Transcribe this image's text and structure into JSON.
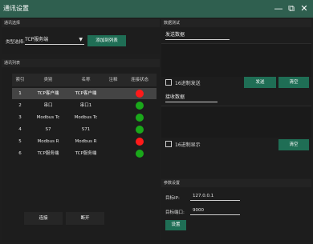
{
  "window": {
    "title": "通讯设置",
    "controls": {
      "minimize": "—",
      "restore": "⧉",
      "close": "✕"
    }
  },
  "left": {
    "comm_select_header": "通讯选择",
    "type_label": "类型选择:",
    "type_value": "TCP服务端",
    "add_button": "添加到列表",
    "list_header": "通讯列表",
    "columns": [
      "索引",
      "类别",
      "名称",
      "注释",
      "连接状态"
    ],
    "rows": [
      {
        "index": "1",
        "type": "TCP客户端",
        "name": "TCP客户端",
        "note": "",
        "status": "red",
        "selected": true
      },
      {
        "index": "2",
        "type": "串口",
        "name": "串口1",
        "note": "",
        "status": "green",
        "selected": false
      },
      {
        "index": "3",
        "type": "Modbus Tc",
        "name": "Modbus Tc",
        "note": "",
        "status": "green",
        "selected": false
      },
      {
        "index": "4",
        "type": "S7",
        "name": "S71",
        "note": "",
        "status": "green",
        "selected": false
      },
      {
        "index": "5",
        "type": "Modbus R",
        "name": "Modbus R",
        "note": "",
        "status": "red",
        "selected": false
      },
      {
        "index": "6",
        "type": "TCP服务端",
        "name": "TCP服务端",
        "note": "",
        "status": "green",
        "selected": false
      }
    ],
    "connect_button": "连接",
    "disconnect_button": "断开"
  },
  "right": {
    "data_test_header": "数据测试",
    "send_data_label": "发送数据",
    "hex_send_label": "16进制发送",
    "send_button": "发送",
    "clear_send_button": "清空",
    "receive_data_label": "接收数据",
    "hex_display_label": "16进制显示",
    "clear_receive_button": "清空",
    "params_header": "参数设置",
    "target_ip_label": "目标IP:",
    "target_ip_value": "127.0.0.1",
    "target_port_label": "目标端口:",
    "target_port_value": "9000",
    "set_button": "设置"
  },
  "colors": {
    "accent": "#1f6e55",
    "titlebar": "#2f5f4f",
    "status_red": "#ff1a1a",
    "status_green": "#1aa81a"
  }
}
